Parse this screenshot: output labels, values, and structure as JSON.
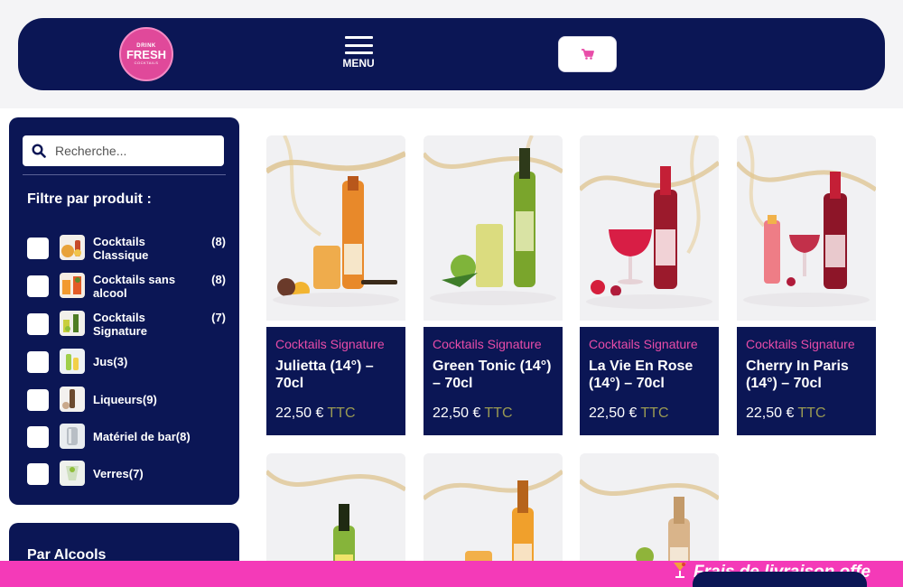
{
  "header": {
    "logo": {
      "top": "DRINK",
      "main": "FRESH",
      "sub": "COCKTAILS"
    },
    "menu_label": "MENU",
    "icons": {
      "menu": "hamburger-icon",
      "cart": "cart-icon"
    },
    "colors": {
      "brand": "#0b1655",
      "accent": "#e0499a"
    }
  },
  "sidebar": {
    "search_placeholder": "Recherche...",
    "filter_title": "Filtre par produit :",
    "items": [
      {
        "label": "Cocktails Classique",
        "count": "(8)"
      },
      {
        "label": "Cocktails sans alcool",
        "count": "(8)"
      },
      {
        "label": "Cocktails Signature",
        "count": "(7)"
      },
      {
        "label": "Jus(3)"
      },
      {
        "label": "Liqueurs(9)"
      },
      {
        "label": "Matériel de bar(8)"
      },
      {
        "label": "Verres(7)"
      }
    ],
    "section2_title": "Par Alcools"
  },
  "products": [
    {
      "category": "Cocktails Signature",
      "name": "Julietta (14°) – 70cl",
      "price": "22,50 €",
      "tax": "TTC"
    },
    {
      "category": "Cocktails Signature",
      "name": "Green Tonic (14°) – 70cl",
      "price": "22,50 €",
      "tax": "TTC"
    },
    {
      "category": "Cocktails Signature",
      "name": "La Vie En Rose (14°) – 70cl",
      "price": "22,50 €",
      "tax": "TTC"
    },
    {
      "category": "Cocktails Signature",
      "name": "Cherry In Paris (14°) – 70cl",
      "price": "22,50 €",
      "tax": "TTC"
    }
  ],
  "banner": {
    "text": "Frais de livraison offe",
    "icon": "cocktail-icon"
  }
}
